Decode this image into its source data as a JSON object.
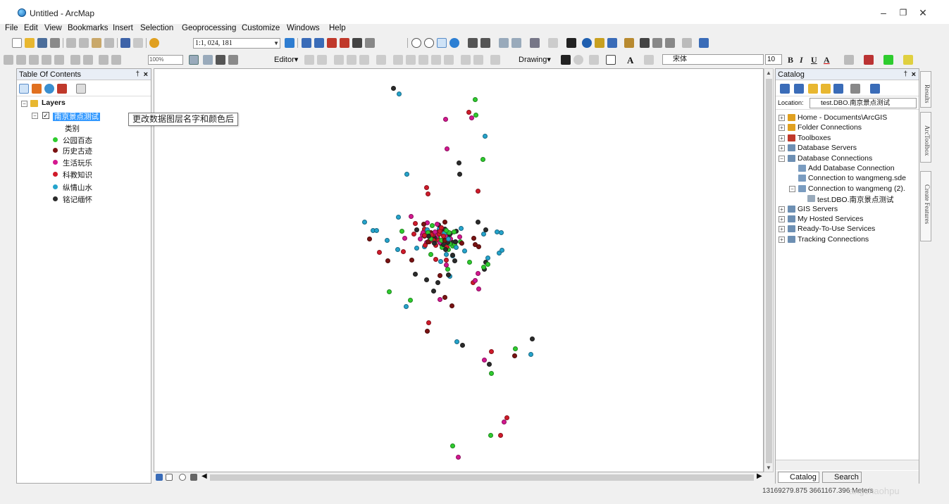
{
  "window": {
    "title": "Untitled - ArcMap"
  },
  "menu": [
    "File",
    "Edit",
    "View",
    "Bookmarks",
    "Insert",
    "Selection",
    "Geoprocessing",
    "Customize",
    "Windows",
    "Help"
  ],
  "toolbar": {
    "scale": "1:1, 024, 181",
    "zoom_percent": "100%",
    "editor_label": "Editor▾",
    "drawing_label": "Drawing▾",
    "font_name": "宋体",
    "font_size": "10",
    "bold": "B",
    "italic": "I",
    "underline": "U"
  },
  "toc": {
    "title": "Table Of Contents",
    "layers_label": "Layers",
    "layer_name": "南京景点测试",
    "legend_heading": "类别",
    "legend": [
      {
        "label": "公园百态",
        "color": "#2ecc2e"
      },
      {
        "label": "历史古迹",
        "color": "#7a1212"
      },
      {
        "label": "生活玩乐",
        "color": "#d4178f"
      },
      {
        "label": "科教知识",
        "color": "#d01a2a"
      },
      {
        "label": "纵情山水",
        "color": "#25a4cc"
      },
      {
        "label": "铭记缅怀",
        "color": "#2b2b2b"
      }
    ]
  },
  "tooltip": "更改数据图层名字和颜色后",
  "catalog": {
    "title": "Catalog",
    "location_label": "Location:",
    "location_value": "test.DBO.南京景点测试",
    "tree": [
      {
        "label": "Home - Documents\\ArcGIS",
        "level": 0,
        "expander": "+",
        "icon": "#e0a020"
      },
      {
        "label": "Folder Connections",
        "level": 0,
        "expander": "+",
        "icon": "#e0a020"
      },
      {
        "label": "Toolboxes",
        "level": 0,
        "expander": "+",
        "icon": "#c0392b"
      },
      {
        "label": "Database Servers",
        "level": 0,
        "expander": "+",
        "icon": "#6d8fb3"
      },
      {
        "label": "Database Connections",
        "level": 0,
        "expander": "−",
        "icon": "#6d8fb3"
      },
      {
        "label": "Add Database Connection",
        "level": 1,
        "expander": "",
        "icon": "#7a9cc0"
      },
      {
        "label": "Connection to wangmeng.sde",
        "level": 1,
        "expander": "",
        "icon": "#7a9cc0"
      },
      {
        "label": "Connection to wangmeng (2).",
        "level": 1,
        "expander": "−",
        "icon": "#7a9cc0"
      },
      {
        "label": "test.DBO.南京景点测试",
        "level": 2,
        "expander": "",
        "icon": "#9ab"
      },
      {
        "label": "GIS Servers",
        "level": 0,
        "expander": "+",
        "icon": "#6d8fb3"
      },
      {
        "label": "My Hosted Services",
        "level": 0,
        "expander": "+",
        "icon": "#6d8fb3"
      },
      {
        "label": "Ready-To-Use Services",
        "level": 0,
        "expander": "+",
        "icon": "#6d8fb3"
      },
      {
        "label": "Tracking Connections",
        "level": 0,
        "expander": "+",
        "icon": "#6d8fb3"
      }
    ],
    "tabs": [
      "Catalog",
      "Search"
    ]
  },
  "side_tabs": [
    "Results",
    "ArcToolbox",
    "Create Features"
  ],
  "status": {
    "coordinates": "13169279.875  3661167.396 Meters"
  },
  "watermark": "angchaohpu"
}
